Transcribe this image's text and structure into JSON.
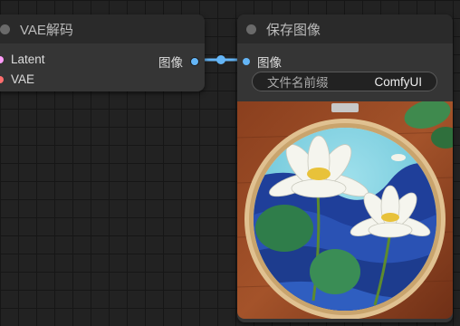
{
  "vae_decode_node": {
    "title": "VAE解码",
    "inputs": [
      {
        "label": "Latent",
        "color": "#ff9cf9"
      },
      {
        "label": "VAE",
        "color": "#ff6e6e"
      }
    ],
    "output": {
      "label": "图像",
      "color": "#64b5f6"
    }
  },
  "save_image_node": {
    "title": "保存图像",
    "input": {
      "label": "图像",
      "color": "#64b5f6"
    },
    "filename_prefix": {
      "label": "文件名前缀",
      "value": "ComfyUI"
    }
  },
  "link_color": "#64b5f6",
  "canvas_background": "#222222",
  "node_background": "#353535"
}
